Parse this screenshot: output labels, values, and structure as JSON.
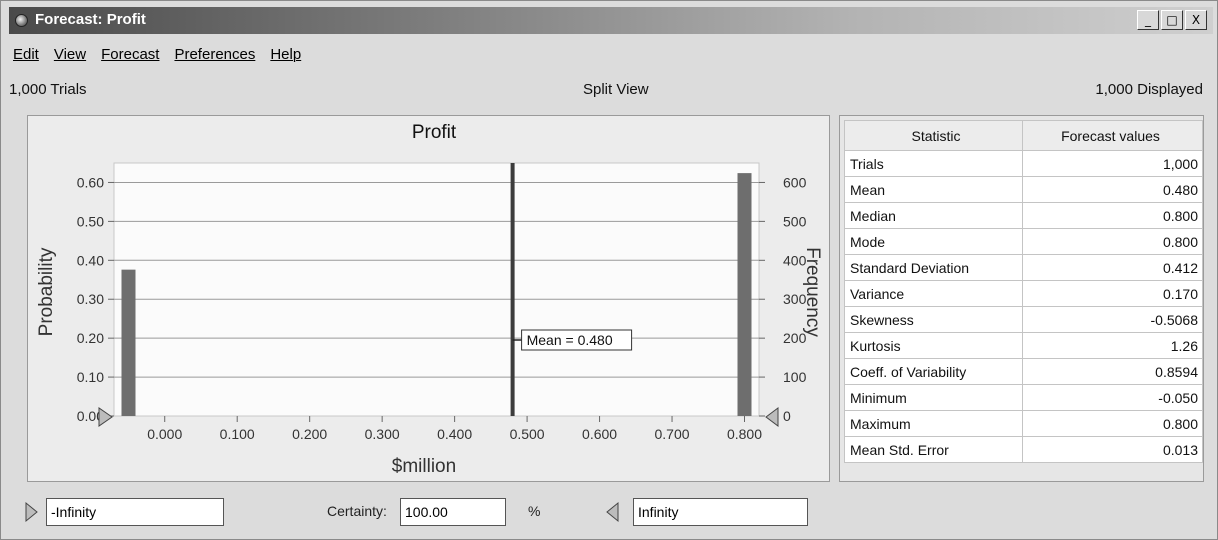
{
  "window": {
    "title": "Forecast: Profit",
    "minimize": "_",
    "maximize": "□",
    "close": "X"
  },
  "menu": [
    "Edit",
    "View",
    "Forecast",
    "Preferences",
    "Help"
  ],
  "info": {
    "trials": "1,000 Trials",
    "view": "Split View",
    "displayed": "1,000 Displayed"
  },
  "chart_data": {
    "type": "bar",
    "title": "Profit",
    "xlabel": "$million",
    "ylabel": "Probability",
    "y2label": "Frequency",
    "xticks": [
      "0.000",
      "0.100",
      "0.200",
      "0.300",
      "0.400",
      "0.500",
      "0.600",
      "0.700",
      "0.800"
    ],
    "yticks": [
      "0.00",
      "0.10",
      "0.20",
      "0.30",
      "0.40",
      "0.50",
      "0.60"
    ],
    "y2ticks": [
      "0",
      "100",
      "200",
      "300",
      "400",
      "500",
      "600"
    ],
    "xlim": [
      -0.07,
      0.82
    ],
    "ylim": [
      0,
      0.65
    ],
    "x": [
      -0.05,
      0.8
    ],
    "values": [
      0.376,
      0.624
    ],
    "mean_line": 0.48,
    "mean_label": "Mean = 0.480",
    "grid": true,
    "colors": {
      "bar": "#6e6e6e",
      "mean": "#3c3c3c",
      "plot_bg": "#fbfbfb"
    }
  },
  "stats": {
    "headers": [
      "Statistic",
      "Forecast values"
    ],
    "rows": [
      [
        "Trials",
        "1,000"
      ],
      [
        "Mean",
        "0.480"
      ],
      [
        "Median",
        "0.800"
      ],
      [
        "Mode",
        "0.800"
      ],
      [
        "Standard Deviation",
        "0.412"
      ],
      [
        "Variance",
        "0.170"
      ],
      [
        "Skewness",
        "-0.5068"
      ],
      [
        "Kurtosis",
        "1.26"
      ],
      [
        "Coeff. of Variability",
        "0.8594"
      ],
      [
        "Minimum",
        "-0.050"
      ],
      [
        "Maximum",
        "0.800"
      ],
      [
        "Mean Std. Error",
        "0.013"
      ]
    ]
  },
  "certainty": {
    "lower": "-Infinity",
    "label": "Certainty:",
    "value": "100.00",
    "unit": "%",
    "upper": "Infinity"
  }
}
